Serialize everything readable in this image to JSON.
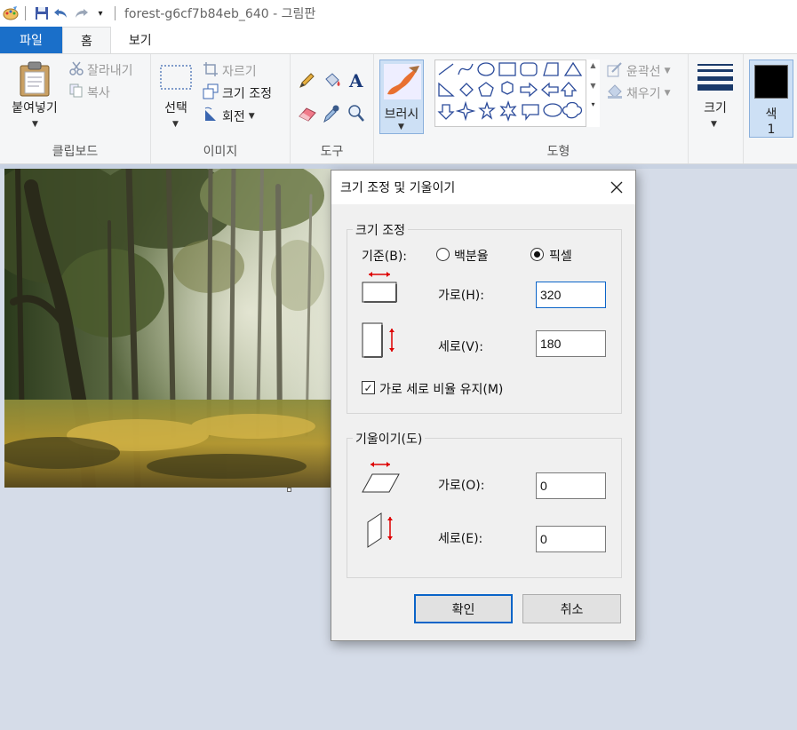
{
  "app": {
    "title": "forest-g6cf7b84eb_640 - 그림판"
  },
  "tabs": [
    {
      "label": "파일"
    },
    {
      "label": "홈"
    },
    {
      "label": "보기"
    }
  ],
  "ribbon": {
    "clipboard": {
      "paste_label": "붙여넣기",
      "cut_label": "잘라내기",
      "copy_label": "복사",
      "group_label": "클립보드"
    },
    "image": {
      "select_label": "선택",
      "crop_label": "자르기",
      "resize_label": "크기 조정",
      "rotate_label": "회전",
      "group_label": "이미지"
    },
    "tools": {
      "group_label": "도구"
    },
    "brush_label": "브러시",
    "shapes": {
      "outline_label": "윤곽선",
      "fill_label": "채우기",
      "group_label": "도형"
    },
    "size_label": "크기",
    "color1_label": "색",
    "color1_index": "1",
    "color1_value": "#000000"
  },
  "dialog": {
    "title": "크기 조정 및 기울이기",
    "resize": {
      "legend": "크기 조정",
      "basis_label": "기준(B):",
      "percent_label": "백분율",
      "pixel_label": "픽셀",
      "selected": "pixel",
      "horizontal_label": "가로(H):",
      "horizontal_value": "320",
      "vertical_label": "세로(V):",
      "vertical_value": "180",
      "keep_ratio_label": "가로 세로 비율 유지(M)",
      "keep_ratio_checked": true
    },
    "skew": {
      "legend": "기울이기(도)",
      "horizontal_label": "가로(O):",
      "horizontal_value": "0",
      "vertical_label": "세로(E):",
      "vertical_value": "0"
    },
    "ok_label": "확인",
    "cancel_label": "취소"
  }
}
